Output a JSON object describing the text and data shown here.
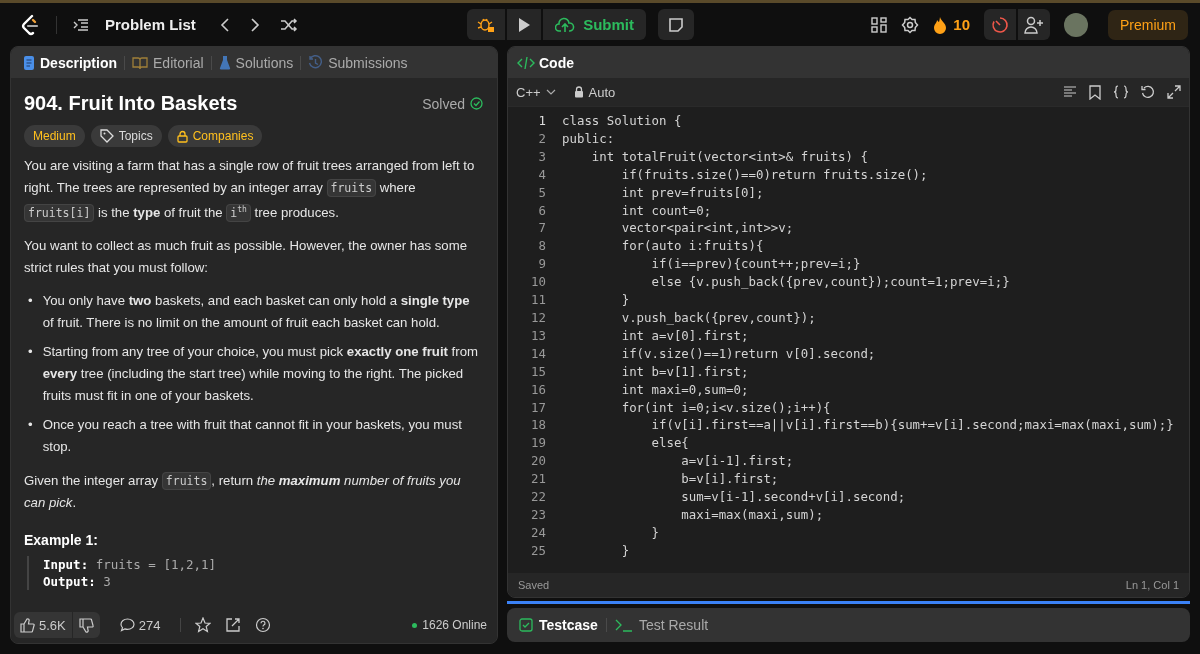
{
  "topbar": {
    "problem_list": "Problem List",
    "submit": "Submit",
    "streak": "10",
    "premium": "Premium"
  },
  "description_panel": {
    "tabs": [
      {
        "label": "Description",
        "selected": true,
        "kind": "doc"
      },
      {
        "label": "Editorial",
        "selected": false,
        "kind": "book"
      },
      {
        "label": "Solutions",
        "selected": false,
        "kind": "flask"
      },
      {
        "label": "Submissions",
        "selected": false,
        "kind": "history"
      }
    ],
    "title": "904. Fruit Into Baskets",
    "status": "Solved",
    "tags": [
      {
        "label": "Medium",
        "kind": "difficulty"
      },
      {
        "label": "Topics",
        "kind": "topics"
      },
      {
        "label": "Companies",
        "kind": "companies"
      }
    ],
    "paragraphs": [
      {
        "kind": "paragraph",
        "segments": [
          {
            "kind": "text",
            "text": "You are visiting a farm that has a single row of fruit trees arranged from left to right. The trees are represented by an integer array "
          },
          {
            "kind": "code",
            "text": "fruits"
          },
          {
            "kind": "text",
            "text": " where "
          },
          {
            "kind": "code",
            "text": "fruits[i]"
          },
          {
            "kind": "text",
            "text": " is the **type** of fruit the "
          },
          {
            "kind": "code",
            "text": "i$^{th}$"
          },
          {
            "kind": "text",
            "text": " tree produces."
          }
        ]
      },
      {
        "kind": "paragraph",
        "segments": [
          {
            "kind": "text",
            "text": "You want to collect as much fruit as possible. However, the owner has some strict rules that you must follow:"
          }
        ]
      },
      {
        "kind": "bullet",
        "marker": "•",
        "segments": [
          {
            "kind": "text",
            "text": "You only have **two** baskets, and each basket can only hold a **single type** of fruit. There is no limit on the amount of fruit each basket can hold."
          }
        ]
      },
      {
        "kind": "bullet",
        "marker": "•",
        "segments": [
          {
            "kind": "text",
            "text": "Starting from any tree of your choice, you must pick **exactly one fruit** from **every** tree (including the start tree) while moving to the right. The picked fruits must fit in one of your baskets."
          }
        ]
      },
      {
        "kind": "bullet",
        "marker": "•",
        "segments": [
          {
            "kind": "text",
            "text": "Once you reach a tree with fruit that cannot fit in your baskets, you must stop."
          }
        ]
      },
      {
        "kind": "paragraph",
        "segments": [
          {
            "kind": "text",
            "text": "Given the integer array "
          },
          {
            "kind": "code",
            "text": "fruits"
          },
          {
            "kind": "text",
            "text": ", return "
          },
          {
            "kind": "italic",
            "text": "the **maximum** number of fruits you can pick"
          },
          {
            "kind": "text",
            "text": "."
          }
        ]
      }
    ],
    "example": {
      "heading": "Example 1:",
      "lines": [
        {
          "label": "Input:",
          "value": "fruits = [1,2,1]"
        },
        {
          "label": "Output:",
          "value": "3"
        }
      ]
    },
    "footer": {
      "likes": "5.6K",
      "comments": "274",
      "online": "1626 Online"
    }
  },
  "code_panel": {
    "title": "Code",
    "language": "C++",
    "mode": "Auto",
    "lines": [
      "class Solution {",
      "public:",
      "    int totalFruit(vector<int>& fruits) {",
      "        if(fruits.size()==0)return fruits.size();",
      "        int prev=fruits[0];",
      "        int count=0;",
      "        vector<pair<int,int>>v;",
      "        for(auto i:fruits){",
      "            if(i==prev){count++;prev=i;}",
      "            else {v.push_back({prev,count});count=1;prev=i;}",
      "        }",
      "        v.push_back({prev,count});",
      "        int a=v[0].first;",
      "        if(v.size()==1)return v[0].second;",
      "        int b=v[1].first;",
      "        int maxi=0,sum=0;",
      "        for(int i=0;i<v.size();i++){",
      "            if(v[i].first==a||v[i].first==b){sum+=v[i].second;maxi=max(maxi,sum);}",
      "            else{",
      "                a=v[i-1].first;",
      "                b=v[i].first;",
      "                sum=v[i-1].second+v[i].second;",
      "                maxi=max(maxi,sum);",
      "            }",
      "        }"
    ],
    "line_numbers": [
      "1",
      "2",
      "3",
      "4",
      "5",
      "6",
      "7",
      "8",
      "9",
      "10",
      "11",
      "12",
      "13",
      "14",
      "15",
      "16",
      "17",
      "18",
      "19",
      "20",
      "21",
      "22",
      "23",
      "24",
      "25"
    ],
    "status": "Saved",
    "cursor": "Ln 1, Col 1"
  },
  "bottom_panel": {
    "tabs": [
      {
        "label": "Testcase",
        "selected": true
      },
      {
        "label": "Test Result",
        "selected": false
      }
    ]
  }
}
